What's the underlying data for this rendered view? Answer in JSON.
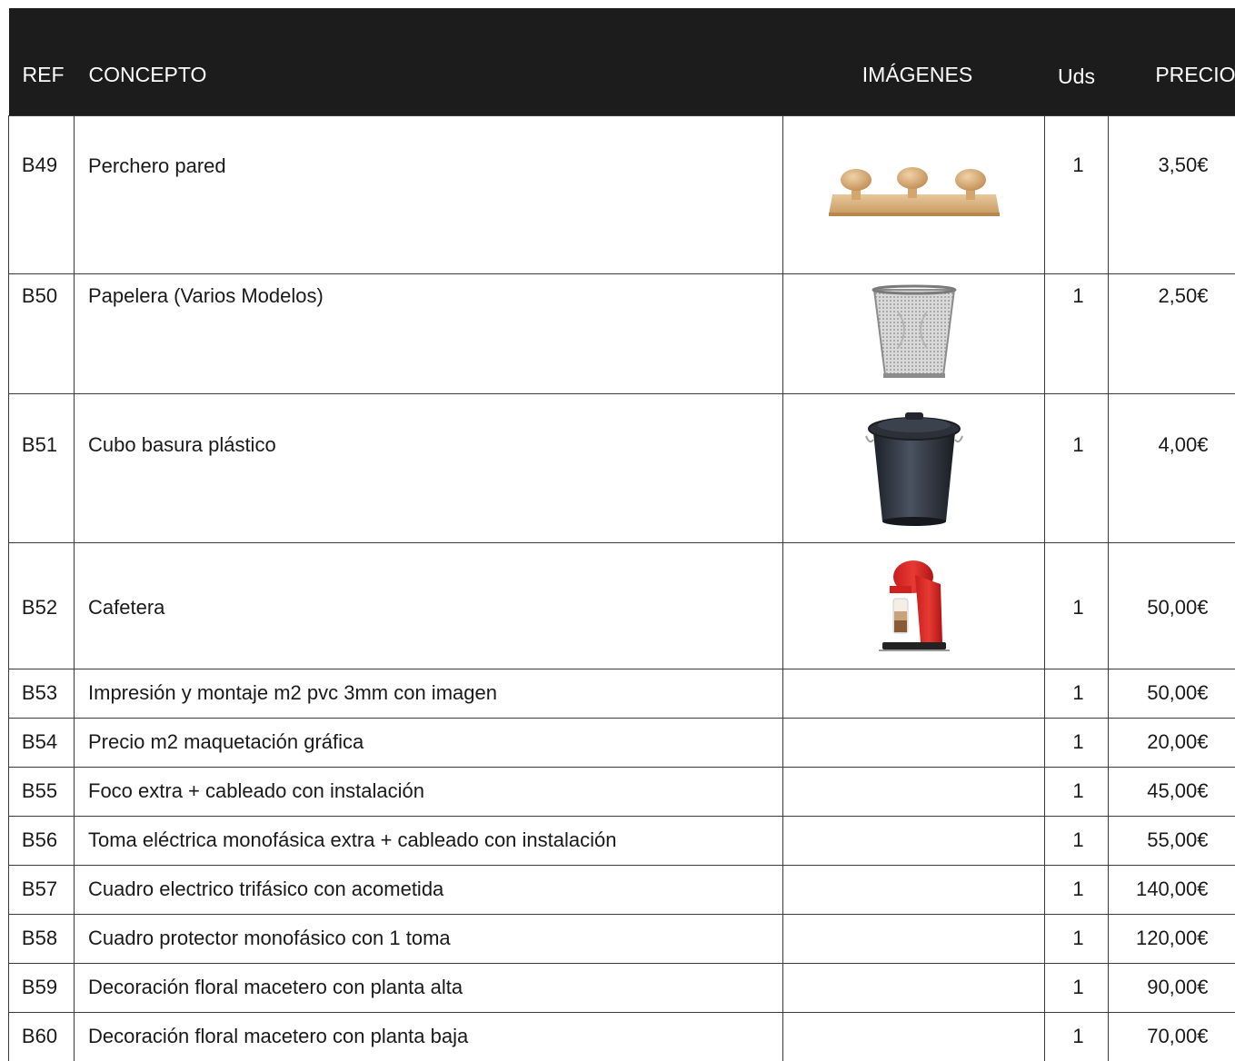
{
  "header": {
    "ref": "REF",
    "concepto": "CONCEPTO",
    "imagenes": "IMÁGENES",
    "uds": "Uds",
    "precio": "PRECIO"
  },
  "rows": [
    {
      "ref": "B49",
      "concepto": "Perchero pared",
      "uds": "1",
      "precio": "3,50€",
      "image": "wooden-coat-rack-icon"
    },
    {
      "ref": "B50",
      "concepto": "Papelera (Varios Modelos)",
      "uds": "1",
      "precio": "2,50€",
      "image": "mesh-wastebasket-icon"
    },
    {
      "ref": "B51",
      "concepto": "Cubo basura plástico",
      "uds": "1",
      "precio": "4,00€",
      "image": "plastic-trash-can-icon"
    },
    {
      "ref": "B52",
      "concepto": "Cafetera",
      "uds": "1",
      "precio": "50,00€",
      "image": "coffee-machine-icon"
    },
    {
      "ref": "B53",
      "concepto": "Impresión y montaje m2 pvc 3mm con imagen",
      "uds": "1",
      "precio": "50,00€"
    },
    {
      "ref": "B54",
      "concepto": "Precio m2 maquetación gráfica",
      "uds": "1",
      "precio": "20,00€"
    },
    {
      "ref": "B55",
      "concepto": "Foco extra + cableado con instalación",
      "uds": "1",
      "precio": "45,00€"
    },
    {
      "ref": "B56",
      "concepto": "Toma eléctrica monofásica extra + cableado con instalación",
      "uds": "1",
      "precio": "55,00€"
    },
    {
      "ref": "B57",
      "concepto": "Cuadro electrico trifásico con acometida",
      "uds": "1",
      "precio": "140,00€"
    },
    {
      "ref": "B58",
      "concepto": "Cuadro protector monofásico con 1 toma",
      "uds": "1",
      "precio": "120,00€"
    },
    {
      "ref": "B59",
      "concepto": "Decoración floral macetero con planta alta",
      "uds": "1",
      "precio": "90,00€"
    },
    {
      "ref": "B60",
      "concepto": "Decoración floral macetero con planta baja",
      "uds": "1",
      "precio": "70,00€"
    }
  ],
  "colors": {
    "header_bg": "#1c1c1c",
    "header_text": "#ffffff",
    "border": "#3a3a3a"
  }
}
